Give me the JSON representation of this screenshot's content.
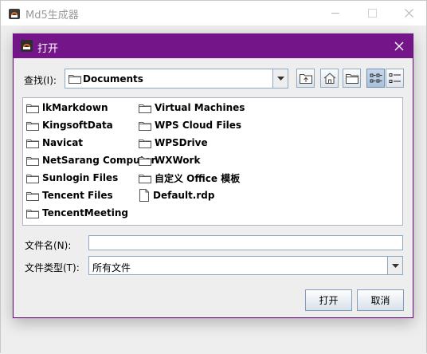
{
  "app": {
    "title": "Md5生成器"
  },
  "dialog": {
    "title": "打开",
    "accent_color": "#74158a",
    "look_in_label": "查找(I):",
    "look_in_value": "Documents",
    "toolbar_icons": [
      "up-folder-icon",
      "home-icon",
      "new-folder-icon",
      "list-view-icon",
      "details-view-icon"
    ],
    "files": [
      {
        "name": "lkMarkdown",
        "type": "folder"
      },
      {
        "name": "KingsoftData",
        "type": "folder"
      },
      {
        "name": "Navicat",
        "type": "folder"
      },
      {
        "name": "NetSarang Computer",
        "type": "folder"
      },
      {
        "name": "Sunlogin Files",
        "type": "folder"
      },
      {
        "name": "Tencent Files",
        "type": "folder"
      },
      {
        "name": "TencentMeeting",
        "type": "folder"
      },
      {
        "name": "Virtual Machines",
        "type": "folder"
      },
      {
        "name": "WPS Cloud Files",
        "type": "folder"
      },
      {
        "name": "WPSDrive",
        "type": "folder"
      },
      {
        "name": "WXWork",
        "type": "folder"
      },
      {
        "name": "自定义 Office 模板",
        "type": "folder"
      },
      {
        "name": "Default.rdp",
        "type": "file"
      }
    ],
    "file_name_label": "文件名(N):",
    "file_name_value": "",
    "file_type_label": "文件类型(T):",
    "file_type_value": "所有文件",
    "open_button": "打开",
    "cancel_button": "取消"
  }
}
